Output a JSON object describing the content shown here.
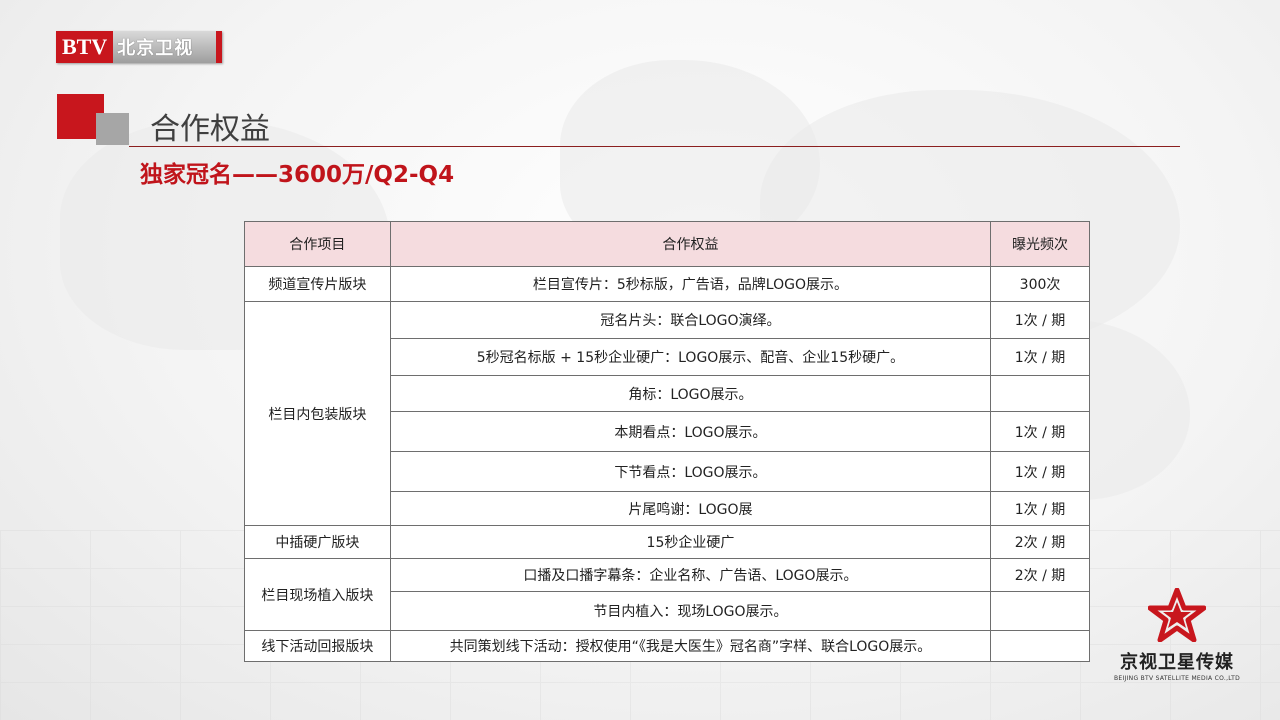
{
  "header": {
    "logo_btv": "BTV",
    "logo_channel": "北京卫视",
    "section_title": "合作权益",
    "subtitle": "独家冠名——3600万/Q2-Q4"
  },
  "table": {
    "headers": [
      "合作项目",
      "合作权益",
      "曝光频次"
    ],
    "rows": [
      {
        "item": "频道宣传片版块",
        "benefit": "栏目宣传片：5秒标版，广告语，品牌LOGO展示。",
        "freq": "300次"
      },
      {
        "item": "栏目内包装版块",
        "benefit": "冠名片头：联合LOGO演绎。",
        "freq": "1次 / 期"
      },
      {
        "item": "",
        "benefit": "5秒冠名标版 + 15秒企业硬广：LOGO展示、配音、企业15秒硬广。",
        "freq": "1次 / 期"
      },
      {
        "item": "",
        "benefit": "角标：LOGO展示。",
        "freq": ""
      },
      {
        "item": "",
        "benefit": "本期看点：LOGO展示。",
        "freq": "1次 / 期"
      },
      {
        "item": "",
        "benefit": "下节看点：LOGO展示。",
        "freq": "1次 / 期"
      },
      {
        "item": "",
        "benefit": "片尾鸣谢：LOGO展",
        "freq": "1次 / 期"
      },
      {
        "item": "中插硬广版块",
        "benefit": "15秒企业硬广",
        "freq": "2次 / 期"
      },
      {
        "item": "栏目现场植入版块",
        "benefit": "口播及口播字幕条：企业名称、广告语、LOGO展示。",
        "freq": "2次 / 期"
      },
      {
        "item": "",
        "benefit": "节目内植入：现场LOGO展示。",
        "freq": ""
      },
      {
        "item": "线下活动回报版块",
        "benefit": "共同策划线下活动：授权使用“《我是大医生》冠名商”字样、联合LOGO展示。",
        "freq": ""
      }
    ]
  },
  "footer_logo": {
    "name_cn": "京视卫星传媒",
    "name_en": "BEIJING BTV SATELLITE MEDIA CO.,LTD",
    "icon": "red-star-icon"
  },
  "colors": {
    "brand_red": "#c8161d",
    "header_fill": "#f5dcdf"
  }
}
